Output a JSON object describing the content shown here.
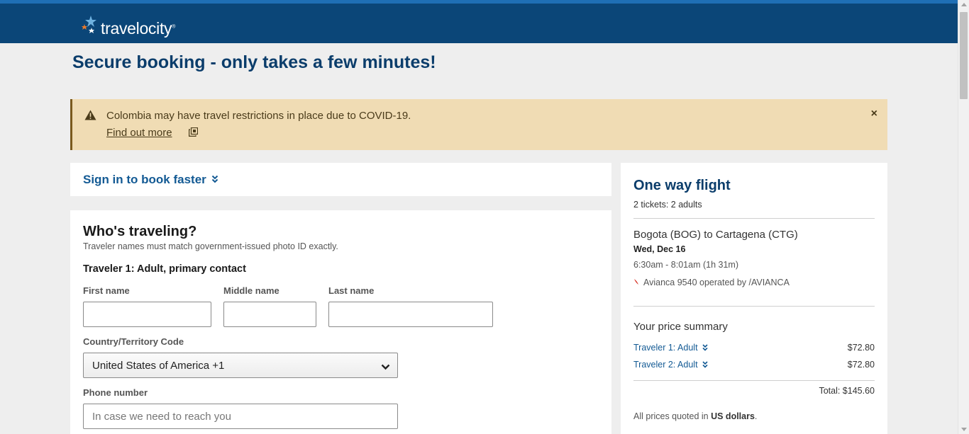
{
  "header": {
    "logo_text": "travelocity",
    "logo_mark": "®"
  },
  "page": {
    "title": "Secure booking - only takes a few minutes!"
  },
  "alert": {
    "message": "Colombia may have travel restrictions in place due to COVID-19.",
    "link_label": "Find out more",
    "close_icon": "×",
    "background": "#f0dcb4"
  },
  "signin": {
    "label": "Sign in to book faster"
  },
  "travelers": {
    "title": "Who's traveling?",
    "subtitle": "Traveler names must match government-issued photo ID exactly.",
    "traveler_heading": "Traveler 1: Adult, primary contact",
    "first_name_label": "First name",
    "middle_name_label": "Middle name",
    "last_name_label": "Last name",
    "first_name_value": "",
    "middle_name_value": "",
    "last_name_value": "",
    "country_code_label": "Country/Territory Code",
    "country_code_value": "United States of America +1",
    "phone_label": "Phone number",
    "phone_placeholder": "In case we need to reach you"
  },
  "summary": {
    "title": "One way flight",
    "tickets": "2 tickets: 2 adults",
    "route": "Bogota (BOG) to Cartagena (CTG)",
    "date": "Wed, Dec 16",
    "times": "6:30am - 8:01am (1h 31m)",
    "airline": "Avianca 9540 operated by /AVIANCA",
    "price_title": "Your price summary",
    "prices": [
      {
        "label": "Traveler 1: Adult",
        "amount": "$72.80"
      },
      {
        "label": "Traveler 2: Adult",
        "amount": "$72.80"
      }
    ],
    "total": "Total: $145.60",
    "note_prefix": "All prices quoted in ",
    "note_currency": "US dollars",
    "note_suffix": "."
  },
  "colors": {
    "header_bg": "#0b4678",
    "link": "#135a94",
    "title": "#0b3d6b"
  }
}
